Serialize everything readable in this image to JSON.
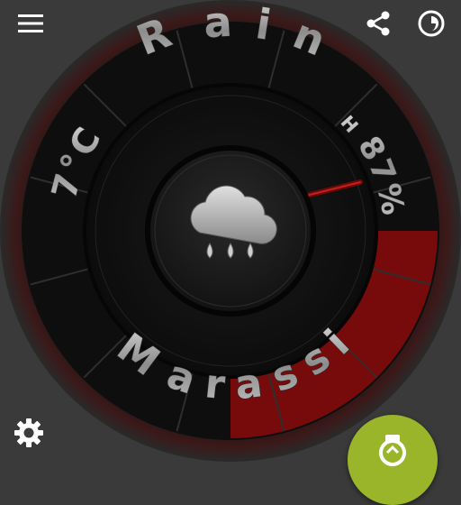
{
  "colors": {
    "background": "#3a3a3a",
    "accent_red": "#8a0a0a",
    "fab_green": "#9bb52a",
    "metal": "#9a9a9a"
  },
  "toolbar": {
    "menu_icon": "hamburger-menu-icon",
    "share_icon": "share-icon",
    "theme_icon": "half-moon-clock-icon",
    "settings_icon": "gear-icon"
  },
  "watchface": {
    "condition": "Rain",
    "temperature": "7°C",
    "humidity_prefix": "H",
    "humidity": "87%",
    "location": "Marassi",
    "weather_icon": "rain-cloud-icon",
    "humidity_level": 0.87
  },
  "fab": {
    "icon": "watch-sync-icon"
  }
}
